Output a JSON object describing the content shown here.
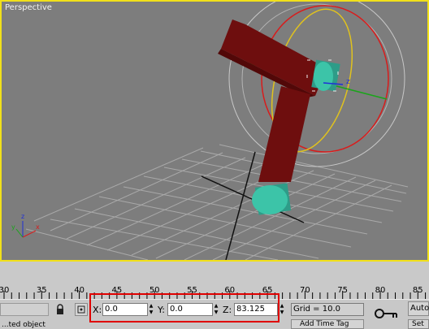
{
  "viewport": {
    "label": "Perspective",
    "gizmo_axis_label": "z"
  },
  "axis_tripod": {
    "z": "z",
    "x": "x",
    "y": "y"
  },
  "timeline": {
    "ticks": [
      "30",
      "35",
      "40",
      "45",
      "50",
      "55",
      "60",
      "65",
      "70",
      "75",
      "80",
      "85"
    ]
  },
  "status": {
    "lock_icon": "lock-icon",
    "absolute_mode_icon": "absolute-mode-icon",
    "x_label": "X:",
    "x_value": "0.0",
    "y_label": "Y:",
    "y_value": "0.0",
    "z_label": "Z:",
    "z_value": "83.125",
    "grid_text": "Grid = 10.0",
    "key_icon": "key-icon",
    "auto_label": "Auto",
    "set_label": "Set",
    "left_partial_text": "...ted object",
    "add_time_tag": "Add Time Tag"
  },
  "colors": {
    "viewport_bg": "#7d7d7d",
    "active_border": "#f1e01a",
    "object_red": "#6e0e0e",
    "cylinder": "#3cc4a8",
    "highlight": "#e00000"
  }
}
